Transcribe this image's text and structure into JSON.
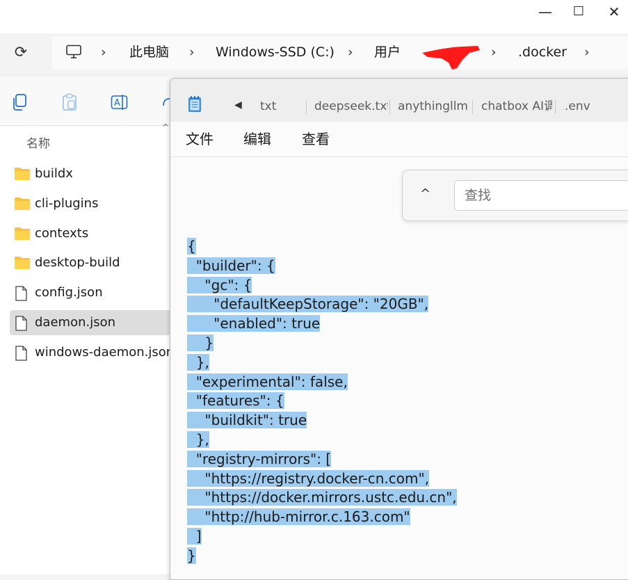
{
  "window": {
    "min_glyph": "—",
    "max_glyph": "☐",
    "close_glyph": "✕"
  },
  "breadcrumb": {
    "sep": "›",
    "items": [
      "此电脑",
      "Windows-SSD (C:)",
      "用户",
      ".docker"
    ]
  },
  "explorer": {
    "column_header": "名称",
    "sort_caret": "^",
    "items": [
      {
        "name": "buildx",
        "type": "folder"
      },
      {
        "name": "cli-plugins",
        "type": "folder"
      },
      {
        "name": "contexts",
        "type": "folder"
      },
      {
        "name": "desktop-build",
        "type": "folder"
      },
      {
        "name": "config.json",
        "type": "file"
      },
      {
        "name": "daemon.json",
        "type": "file",
        "selected": true
      },
      {
        "name": "windows-daemon.json",
        "type": "file"
      }
    ]
  },
  "notepad": {
    "scroll_left_glyph": "◀",
    "tabs": [
      "txt",
      "deepseek.txt",
      "anythingllm笔",
      "chatbox AI调",
      ".env"
    ],
    "menu": [
      "文件",
      "编辑",
      "查看"
    ],
    "find": {
      "up_glyph": "^",
      "placeholder": "查找"
    },
    "content_lines": [
      "{",
      "  \"builder\": {",
      "    \"gc\": {",
      "      \"defaultKeepStorage\": \"20GB\",",
      "      \"enabled\": true",
      "    }",
      "  },",
      "  \"experimental\": false,",
      "  \"features\": {",
      "    \"buildkit\": true",
      "  },",
      "  \"registry-mirrors\": [",
      "    \"https://registry.docker-cn.com\",",
      "    \"https://docker.mirrors.ustc.edu.cn\",",
      "    \"http://hub-mirror.c.163.com\"",
      "  ]",
      "}"
    ],
    "selection_color": "#9ecbf0"
  },
  "icons": {
    "refresh": "refresh-icon",
    "computer": "computer-icon",
    "copy": "copy-icon",
    "paste": "paste-icon",
    "rename": "rename-icon",
    "notepad": "notepad-icon",
    "folder": "folder-icon",
    "file": "file-icon"
  },
  "colors": {
    "folder": "#f5c242",
    "selected_row": "#dddddd",
    "redaction": "#ff1a1a"
  }
}
